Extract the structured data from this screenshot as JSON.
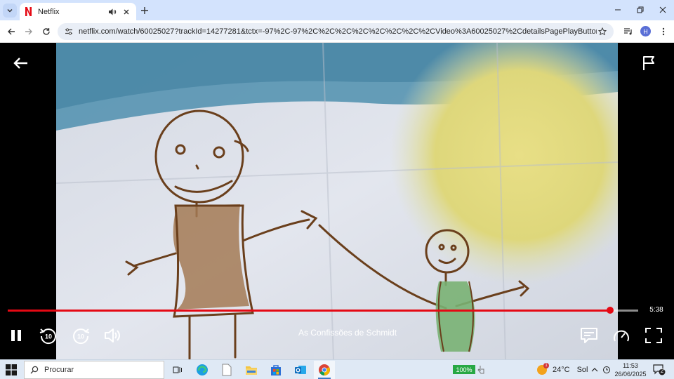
{
  "browser": {
    "tab_title": "Netflix",
    "url": "netflix.com/watch/60025027?trackId=14277281&tctx=-97%2C-97%2C%2C%2C%2C%2C%2C%2C%2CVideo%3A60025027%2CdetailsPagePlayButton",
    "avatar_letter": "H",
    "colors": {
      "tabstrip": "#d3e3fd",
      "netflix_red": "#e50914"
    }
  },
  "player": {
    "title": "As Confissões de Schmidt",
    "time_remaining": "5:38",
    "progress_fraction": 0.955,
    "skip_back_label": "10",
    "skip_forward_label": "10"
  },
  "taskbar": {
    "search_placeholder": "Procurar",
    "battery_percent": "100%",
    "weather_temp": "24°C",
    "weather_desc": "Sol",
    "weather_badge": "1",
    "time": "11:53",
    "date": "26/06/2025",
    "notification_count": "2"
  }
}
